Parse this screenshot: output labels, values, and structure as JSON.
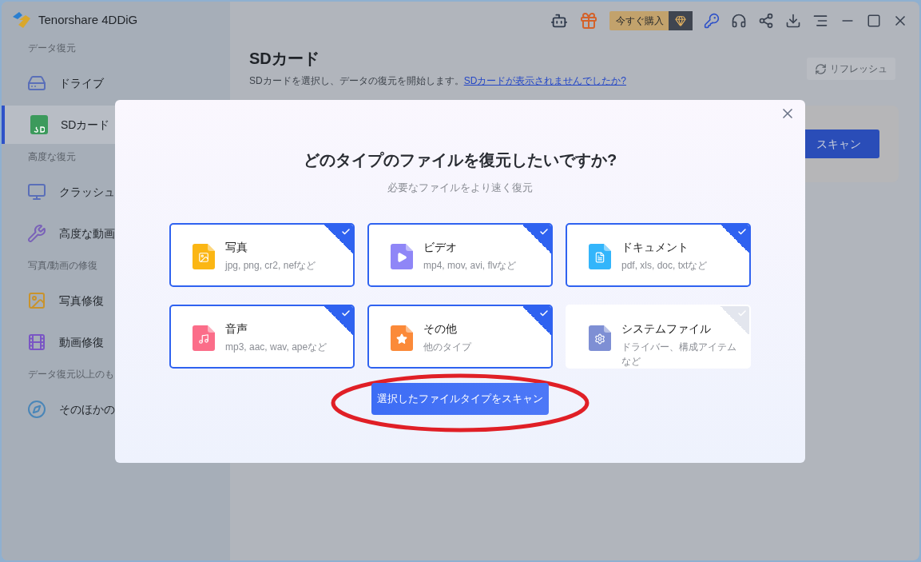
{
  "app": {
    "title": "Tenorshare 4DDiG"
  },
  "sidebar": {
    "sections": [
      {
        "heading": "データ復元",
        "items": [
          {
            "label": "ドライブ",
            "selected": false,
            "kind": "drive"
          },
          {
            "label": "SDカード",
            "selected": true,
            "kind": "sd"
          }
        ]
      },
      {
        "heading": "高度な復元",
        "items": [
          {
            "label": "クラッシュ",
            "selected": false,
            "kind": "computer"
          },
          {
            "label": "高度な動画",
            "selected": false,
            "kind": "video-tool"
          }
        ]
      },
      {
        "heading": "写真/動画の修復",
        "items": [
          {
            "label": "写真修復",
            "selected": false,
            "kind": "photo"
          },
          {
            "label": "動画修復",
            "selected": false,
            "kind": "video"
          }
        ]
      },
      {
        "heading": "データ復元以上のも",
        "items": [
          {
            "label": "そのほかの",
            "selected": false,
            "kind": "compass"
          }
        ]
      }
    ]
  },
  "toolbar": {
    "buy_button": "今すぐ購入"
  },
  "main": {
    "title": "SDカード",
    "description": "SDカードを選択し、データの復元を開始します。",
    "help_link": "SDカードが表示されませんでしたか?",
    "refresh_button": "リフレッシュ",
    "scan_button": "スキャン"
  },
  "dialog": {
    "title": "どのタイプのファイルを復元したいですか?",
    "subtitle": "必要なファイルをより速く復元",
    "file_types": [
      {
        "name": "写真",
        "formats": "jpg, png, cr2, nefなど",
        "kind": "image",
        "color": "#fbb614",
        "selected": true
      },
      {
        "name": "ビデオ",
        "formats": "mp4, mov, avi, flvなど",
        "kind": "video",
        "color": "#8f86f7",
        "selected": true
      },
      {
        "name": "ドキュメント",
        "formats": "pdf, xls, doc, txtなど",
        "kind": "document",
        "color": "#33b5fb",
        "selected": true
      },
      {
        "name": "音声",
        "formats": "mp3, aac, wav, apeなど",
        "kind": "audio",
        "color": "#fb6d89",
        "selected": true
      },
      {
        "name": "その他",
        "formats": "他のタイプ",
        "kind": "other",
        "color": "#fb8a39",
        "selected": true
      },
      {
        "name": "システムファイル",
        "formats": "ドライバー、構成アイテムなど",
        "kind": "system",
        "color": "#7e8fd4",
        "selected": false
      }
    ],
    "scan_button": "選択したファイルタイプをスキャン"
  }
}
